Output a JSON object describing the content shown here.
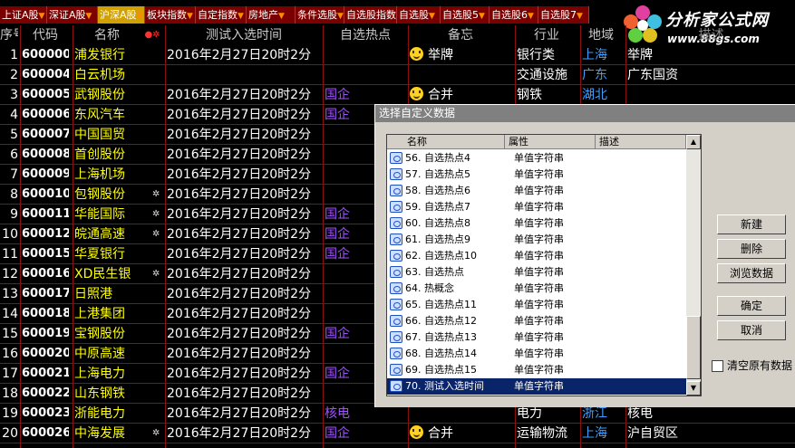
{
  "tabs": [
    {
      "label": "上证A股",
      "active": false
    },
    {
      "label": "深证A股",
      "active": false
    },
    {
      "label": "沪深A股",
      "active": true
    },
    {
      "label": "板块指数",
      "active": false
    },
    {
      "label": "自定指数",
      "active": false
    },
    {
      "label": "房地产",
      "active": false
    },
    {
      "label": "条件选股",
      "active": false
    },
    {
      "label": "自选股指数",
      "active": false
    },
    {
      "label": "自选股",
      "active": false
    },
    {
      "label": "自选股5",
      "active": false
    },
    {
      "label": "自选股6",
      "active": false
    },
    {
      "label": "自选股7",
      "active": false
    }
  ],
  "logo": {
    "title": "分析家公式网",
    "url": "www.88gs.com"
  },
  "columns": {
    "no": "序号",
    "code": "代码",
    "name": "名称",
    "mark": "●✲",
    "time": "测试入选时间",
    "hot": "自选热点",
    "memo": "备忘",
    "industry": "行业",
    "region": "地域",
    "desc": "描述"
  },
  "rows": [
    {
      "no": "1",
      "code": "600000",
      "name": "浦发银行",
      "mark": "",
      "time": "2016年2月27日20时2分",
      "hot": "",
      "memo": "举牌",
      "smile": true,
      "industry": "银行类",
      "region": "上海",
      "desc": "举牌"
    },
    {
      "no": "2",
      "code": "600004",
      "name": "白云机场",
      "mark": "",
      "time": "",
      "hot": "",
      "memo": "",
      "smile": false,
      "industry": "交通设施",
      "region": "广东",
      "desc": "广东国资"
    },
    {
      "no": "3",
      "code": "600005",
      "name": "武钢股份",
      "mark": "",
      "time": "2016年2月27日20时2分",
      "hot": "国企",
      "memo": "合并",
      "smile": true,
      "industry": "钢铁",
      "region": "湖北",
      "desc": ""
    },
    {
      "no": "4",
      "code": "600006",
      "name": "东风汽车",
      "mark": "",
      "time": "2016年2月27日20时2分",
      "hot": "国企",
      "memo": "",
      "smile": false,
      "industry": "",
      "region": "",
      "desc": ""
    },
    {
      "no": "5",
      "code": "600007",
      "name": "中国国贸",
      "mark": "",
      "time": "2016年2月27日20时2分",
      "hot": "",
      "memo": "",
      "smile": false,
      "industry": "",
      "region": "",
      "desc": ""
    },
    {
      "no": "6",
      "code": "600008",
      "name": "首创股份",
      "mark": "",
      "time": "2016年2月27日20时2分",
      "hot": "",
      "memo": "",
      "smile": false,
      "industry": "",
      "region": "",
      "desc": ""
    },
    {
      "no": "7",
      "code": "600009",
      "name": "上海机场",
      "mark": "",
      "time": "2016年2月27日20时2分",
      "hot": "",
      "memo": "",
      "smile": false,
      "industry": "",
      "region": "",
      "desc": ""
    },
    {
      "no": "8",
      "code": "600010",
      "name": "包钢股份",
      "mark": "✲",
      "time": "2016年2月27日20时2分",
      "hot": "",
      "memo": "",
      "smile": false,
      "industry": "",
      "region": "",
      "desc": ""
    },
    {
      "no": "9",
      "code": "600011",
      "name": "华能国际",
      "mark": "✲",
      "time": "2016年2月27日20时2分",
      "hot": "国企",
      "memo": "",
      "smile": false,
      "industry": "",
      "region": "",
      "desc": ""
    },
    {
      "no": "10",
      "code": "600012",
      "name": "皖通高速",
      "mark": "✲",
      "time": "2016年2月27日20时2分",
      "hot": "国企",
      "memo": "",
      "smile": false,
      "industry": "",
      "region": "",
      "desc": ""
    },
    {
      "no": "11",
      "code": "600015",
      "name": "华夏银行",
      "mark": "",
      "time": "2016年2月27日20时2分",
      "hot": "国企",
      "memo": "",
      "smile": false,
      "industry": "",
      "region": "",
      "desc": ""
    },
    {
      "no": "12",
      "code": "600016",
      "name": "XD民生银",
      "mark": "✲",
      "time": "2016年2月27日20时2分",
      "hot": "",
      "memo": "",
      "smile": false,
      "industry": "",
      "region": "",
      "desc": ""
    },
    {
      "no": "13",
      "code": "600017",
      "name": "日照港",
      "mark": "",
      "time": "2016年2月27日20时2分",
      "hot": "",
      "memo": "",
      "smile": false,
      "industry": "",
      "region": "",
      "desc": ""
    },
    {
      "no": "14",
      "code": "600018",
      "name": "上港集团",
      "mark": "",
      "time": "2016年2月27日20时2分",
      "hot": "",
      "memo": "",
      "smile": false,
      "industry": "",
      "region": "",
      "desc": ""
    },
    {
      "no": "15",
      "code": "600019",
      "name": "宝钢股份",
      "mark": "",
      "time": "2016年2月27日20时2分",
      "hot": "国企",
      "memo": "",
      "smile": false,
      "industry": "",
      "region": "",
      "desc": ""
    },
    {
      "no": "16",
      "code": "600020",
      "name": "中原高速",
      "mark": "",
      "time": "2016年2月27日20时2分",
      "hot": "",
      "memo": "",
      "smile": false,
      "industry": "",
      "region": "",
      "desc": ""
    },
    {
      "no": "17",
      "code": "600021",
      "name": "上海电力",
      "mark": "",
      "time": "2016年2月27日20时2分",
      "hot": "国企",
      "memo": "",
      "smile": false,
      "industry": "",
      "region": "",
      "desc": ""
    },
    {
      "no": "18",
      "code": "600022",
      "name": "山东钢铁",
      "mark": "",
      "time": "2016年2月27日20时2分",
      "hot": "",
      "memo": "",
      "smile": false,
      "industry": "",
      "region": "",
      "desc": ""
    },
    {
      "no": "19",
      "code": "600023",
      "name": "浙能电力",
      "mark": "",
      "time": "2016年2月27日20时2分",
      "hot": "核电",
      "memo": "",
      "smile": false,
      "industry": "电力",
      "region": "浙江",
      "desc": "核电"
    },
    {
      "no": "20",
      "code": "600026",
      "name": "中海发展",
      "mark": "✲",
      "time": "2016年2月27日20时2分",
      "hot": "国企",
      "memo": "合并",
      "smile": true,
      "industry": "运输物流",
      "region": "上海",
      "desc": "沪自贸区"
    }
  ],
  "dialog": {
    "title": "选择自定义数据",
    "list_headers": {
      "name": "名称",
      "attr": "属性",
      "desc": "描述"
    },
    "items": [
      {
        "name": "56. 自选热点4",
        "attr": "单值字符串",
        "selected": false
      },
      {
        "name": "57. 自选热点5",
        "attr": "单值字符串",
        "selected": false
      },
      {
        "name": "58. 自选热点6",
        "attr": "单值字符串",
        "selected": false
      },
      {
        "name": "59. 自选热点7",
        "attr": "单值字符串",
        "selected": false
      },
      {
        "name": "60. 自选热点8",
        "attr": "单值字符串",
        "selected": false
      },
      {
        "name": "61. 自选热点9",
        "attr": "单值字符串",
        "selected": false
      },
      {
        "name": "62. 自选热点10",
        "attr": "单值字符串",
        "selected": false
      },
      {
        "name": "63. 自选热点",
        "attr": "单值字符串",
        "selected": false
      },
      {
        "name": "64. 热概念",
        "attr": "单值字符串",
        "selected": false
      },
      {
        "name": "65. 自选热点11",
        "attr": "单值字符串",
        "selected": false
      },
      {
        "name": "66. 自选热点12",
        "attr": "单值字符串",
        "selected": false
      },
      {
        "name": "67. 自选热点13",
        "attr": "单值字符串",
        "selected": false
      },
      {
        "name": "68. 自选热点14",
        "attr": "单值字符串",
        "selected": false
      },
      {
        "name": "69. 自选热点15",
        "attr": "单值字符串",
        "selected": false
      },
      {
        "name": "70. 测试入选时间",
        "attr": "单值字符串",
        "selected": true
      }
    ],
    "buttons": {
      "new": "新建",
      "delete": "删除",
      "browse": "浏览数据",
      "ok": "确定",
      "cancel": "取消"
    },
    "checkbox_label": "清空原有数据",
    "checkbox_checked": false
  },
  "colors": {
    "name_text": "#ffff00",
    "hot_text": "#a050ff",
    "region_text": "#3fa0ff",
    "grid_line": "#8a1010",
    "active_tab": "#d2a000",
    "selection": "#0a246a"
  }
}
